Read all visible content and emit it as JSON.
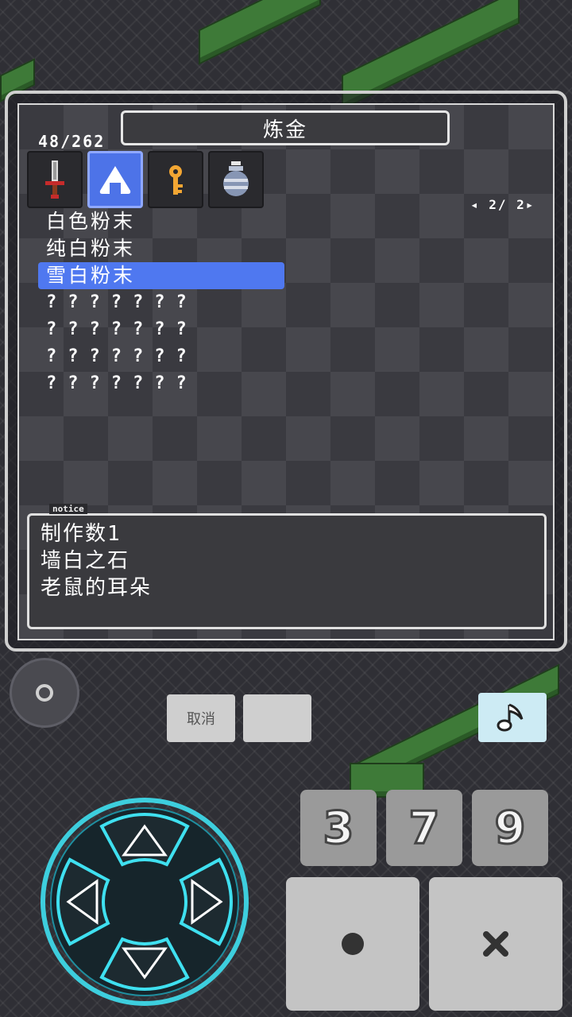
{
  "menu": {
    "title": "炼金",
    "count": "48/262",
    "pager": "◂ 2/ 2▸",
    "tabs": [
      {
        "icon": "sword-icon"
      },
      {
        "icon": "rice-ball-icon",
        "active": true
      },
      {
        "icon": "key-icon"
      },
      {
        "icon": "jar-icon"
      }
    ],
    "items": [
      {
        "label": "白色粉末"
      },
      {
        "label": "纯白粉末"
      },
      {
        "label": "雪白粉末",
        "selected": true
      },
      {
        "label": "???????"
      },
      {
        "label": "???????"
      },
      {
        "label": "???????"
      },
      {
        "label": "???????"
      }
    ]
  },
  "notice": {
    "tag": "notice",
    "lines": [
      "制作数1",
      "墙白之石",
      "老鼠的耳朵"
    ]
  },
  "controls": {
    "cancel_label": "取消",
    "blank_label": "",
    "num_buttons": [
      "3",
      "7",
      "9"
    ]
  },
  "colors": {
    "selection": "#4f78f0",
    "dpad_glow": "#3fe0f0",
    "music_button": "#cdebf4"
  }
}
